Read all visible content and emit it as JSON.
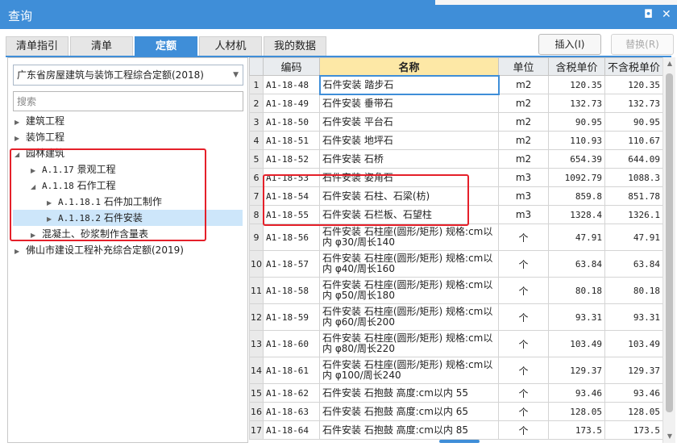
{
  "window": {
    "title": "查询",
    "restore_glyph": "◘",
    "close_glyph": "✕"
  },
  "tabs": [
    {
      "label": "清单指引"
    },
    {
      "label": "清单"
    },
    {
      "label": "定额",
      "active": true
    },
    {
      "label": "人材机"
    },
    {
      "label": "我的数据"
    }
  ],
  "toolbar": {
    "insert_label": "插入(I)",
    "replace_label": "替换(R)"
  },
  "left": {
    "quota_select": "广东省房屋建筑与装饰工程综合定额(2018)",
    "search_placeholder": "搜索",
    "tree": [
      {
        "label": "建筑工程",
        "code": ""
      },
      {
        "label": "装饰工程",
        "code": ""
      },
      {
        "label": "园林建筑",
        "code": ""
      },
      {
        "label": "景观工程",
        "code": "A.1.17"
      },
      {
        "label": "石作工程",
        "code": "A.1.18"
      },
      {
        "label": "石件加工制作",
        "code": "A.1.18.1"
      },
      {
        "label": "石件安装",
        "code": "A.1.18.2",
        "selected": true
      },
      {
        "label": "混凝土、砂浆制作含量表",
        "code": ""
      },
      {
        "label": "佛山市建设工程补充综合定额(2019)",
        "code": ""
      }
    ]
  },
  "table": {
    "headers": {
      "code": "编码",
      "name": "名称",
      "unit": "单位",
      "tax": "含税单价",
      "notax": "不含税单价"
    },
    "rows": [
      {
        "idx": "1",
        "code": "A1-18-48",
        "name": "石件安装 踏步石",
        "unit": "m2",
        "tax": "120.35",
        "notax": "120.35"
      },
      {
        "idx": "2",
        "code": "A1-18-49",
        "name": "石件安装 垂带石",
        "unit": "m2",
        "tax": "132.73",
        "notax": "132.73"
      },
      {
        "idx": "3",
        "code": "A1-18-50",
        "name": "石件安装 平台石",
        "unit": "m2",
        "tax": "90.95",
        "notax": "90.95"
      },
      {
        "idx": "4",
        "code": "A1-18-51",
        "name": "石件安装 地坪石",
        "unit": "m2",
        "tax": "110.93",
        "notax": "110.67"
      },
      {
        "idx": "5",
        "code": "A1-18-52",
        "name": "石件安装 石桥",
        "unit": "m2",
        "tax": "654.39",
        "notax": "644.09"
      },
      {
        "idx": "6",
        "code": "A1-18-53",
        "name": "石件安装 姿角石",
        "unit": "m3",
        "tax": "1092.79",
        "notax": "1088.3"
      },
      {
        "idx": "7",
        "code": "A1-18-54",
        "name": "石件安装 石柱、石梁(枋)",
        "unit": "m3",
        "tax": "859.8",
        "notax": "851.78"
      },
      {
        "idx": "8",
        "code": "A1-18-55",
        "name": "石件安装 石栏板、石望柱",
        "unit": "m3",
        "tax": "1328.4",
        "notax": "1326.1"
      },
      {
        "idx": "9",
        "code": "A1-18-56",
        "name": "石件安装 石柱座(圆形/矩形) 规格:cm以内 φ30/周长140",
        "unit": "个",
        "tax": "47.91",
        "notax": "47.91"
      },
      {
        "idx": "10",
        "code": "A1-18-57",
        "name": "石件安装 石柱座(圆形/矩形) 规格:cm以内 φ40/周长160",
        "unit": "个",
        "tax": "63.84",
        "notax": "63.84"
      },
      {
        "idx": "11",
        "code": "A1-18-58",
        "name": "石件安装 石柱座(圆形/矩形) 规格:cm以内 φ50/周长180",
        "unit": "个",
        "tax": "80.18",
        "notax": "80.18"
      },
      {
        "idx": "12",
        "code": "A1-18-59",
        "name": "石件安装 石柱座(圆形/矩形) 规格:cm以内 φ60/周长200",
        "unit": "个",
        "tax": "93.31",
        "notax": "93.31"
      },
      {
        "idx": "13",
        "code": "A1-18-60",
        "name": "石件安装 石柱座(圆形/矩形) 规格:cm以内 φ80/周长220",
        "unit": "个",
        "tax": "103.49",
        "notax": "103.49"
      },
      {
        "idx": "14",
        "code": "A1-18-61",
        "name": "石件安装 石柱座(圆形/矩形) 规格:cm以内 φ100/周长240",
        "unit": "个",
        "tax": "129.37",
        "notax": "129.37"
      },
      {
        "idx": "15",
        "code": "A1-18-62",
        "name": "石件安装 石抱鼓 高度:cm以内 55",
        "unit": "个",
        "tax": "93.46",
        "notax": "93.46"
      },
      {
        "idx": "16",
        "code": "A1-18-63",
        "name": "石件安装 石抱鼓 高度:cm以内 65",
        "unit": "个",
        "tax": "128.05",
        "notax": "128.05"
      },
      {
        "idx": "17",
        "code": "A1-18-64",
        "name": "石件安装 石抱鼓 高度:cm以内 85",
        "unit": "个",
        "tax": "173.5",
        "notax": "173.5"
      }
    ]
  }
}
